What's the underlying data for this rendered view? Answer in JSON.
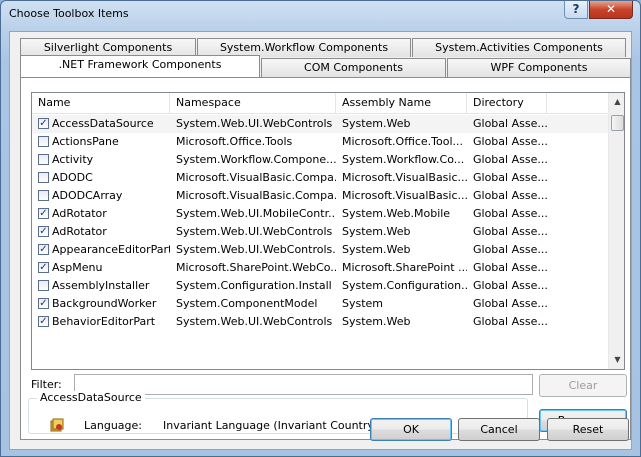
{
  "window": {
    "title": "Choose Toolbox Items",
    "help_label": "?",
    "close_label": "✕"
  },
  "tabs": [
    {
      "label": "Silverlight Components"
    },
    {
      "label": "System.Workflow Components"
    },
    {
      "label": "System.Activities Components"
    },
    {
      "label": ".NET Framework Components",
      "active": true
    },
    {
      "label": "COM Components"
    },
    {
      "label": "WPF Components"
    }
  ],
  "columns": [
    "Name",
    "Namespace",
    "Assembly Name",
    "Directory"
  ],
  "rows": [
    {
      "checked": true,
      "name": "AccessDataSource",
      "namespace": "System.Web.UI.WebControls",
      "assembly": "System.Web",
      "directory": "Global Asse..."
    },
    {
      "checked": false,
      "name": "ActionsPane",
      "namespace": "Microsoft.Office.Tools",
      "assembly": "Microsoft.Office.Tool...",
      "directory": "Global Asse..."
    },
    {
      "checked": false,
      "name": "Activity",
      "namespace": "System.Workflow.Compone...",
      "assembly": "System.Workflow.Co...",
      "directory": "Global Asse..."
    },
    {
      "checked": false,
      "name": "ADODC",
      "namespace": "Microsoft.VisualBasic.Compa...",
      "assembly": "Microsoft.VisualBasic...",
      "directory": "Global Asse..."
    },
    {
      "checked": false,
      "name": "ADODCArray",
      "namespace": "Microsoft.VisualBasic.Compa...",
      "assembly": "Microsoft.VisualBasic...",
      "directory": "Global Asse..."
    },
    {
      "checked": true,
      "name": "AdRotator",
      "namespace": "System.Web.UI.MobileContr...",
      "assembly": "System.Web.Mobile",
      "directory": "Global Asse..."
    },
    {
      "checked": true,
      "name": "AdRotator",
      "namespace": "System.Web.UI.WebControls",
      "assembly": "System.Web",
      "directory": "Global Asse..."
    },
    {
      "checked": true,
      "name": "AppearanceEditorPart",
      "namespace": "System.Web.UI.WebControls....",
      "assembly": "System.Web",
      "directory": "Global Asse..."
    },
    {
      "checked": true,
      "name": "AspMenu",
      "namespace": "Microsoft.SharePoint.WebCo...",
      "assembly": "Microsoft.SharePoint ...",
      "directory": "Global Asse..."
    },
    {
      "checked": false,
      "name": "AssemblyInstaller",
      "namespace": "System.Configuration.Install",
      "assembly": "System.Configuration....",
      "directory": "Global Asse..."
    },
    {
      "checked": true,
      "name": "BackgroundWorker",
      "namespace": "System.ComponentModel",
      "assembly": "System",
      "directory": "Global Asse..."
    },
    {
      "checked": true,
      "name": "BehaviorEditorPart",
      "namespace": "System.Web.UI.WebControls",
      "assembly": "System.Web",
      "directory": "Global Asse..."
    }
  ],
  "filter": {
    "label": "Filter:",
    "value": ""
  },
  "clear_label": "Clear",
  "details": {
    "group_title": "AccessDataSource",
    "language_label": "Language:",
    "language_value": "Invariant Language (Invariant Country)"
  },
  "browse_label": "Browse...",
  "ok_label": "OK",
  "cancel_label": "Cancel",
  "reset_label": "Reset",
  "scroll": {
    "up": "▲",
    "down": "▼"
  }
}
